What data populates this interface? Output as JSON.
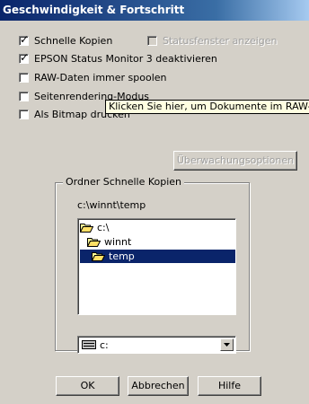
{
  "window": {
    "title": "Geschwindigkeit & Fortschritt"
  },
  "options": {
    "schnelle_kopien": {
      "label": "Schnelle Kopien",
      "checked": true
    },
    "statusfenster": {
      "label": "Statusfenster anzeigen",
      "checked": false,
      "disabled": true
    },
    "status_monitor": {
      "label": "EPSON Status Monitor 3 deaktivieren",
      "checked": true
    },
    "raw_spoolen": {
      "label": "RAW-Daten immer spoolen",
      "checked": false
    },
    "seitenrendering": {
      "label": "Seitenrendering-Modus",
      "checked": false
    },
    "bitmap": {
      "label": "Als Bitmap drucken",
      "checked": false
    }
  },
  "tooltip": {
    "text": "Klicken Sie hier, um Dokumente im RAW- statt EMF-Format zu spoolen."
  },
  "buttons": {
    "monitoring": "Überwachungsoptionen",
    "ok": "OK",
    "cancel": "Abbrechen",
    "help": "Hilfe"
  },
  "folder_group": {
    "legend": "Ordner Schnelle Kopien",
    "current_path": "c:\\winnt\\temp",
    "tree": [
      "c:\\",
      "winnt",
      "temp"
    ],
    "selected_index": 2,
    "drive": "c:"
  }
}
